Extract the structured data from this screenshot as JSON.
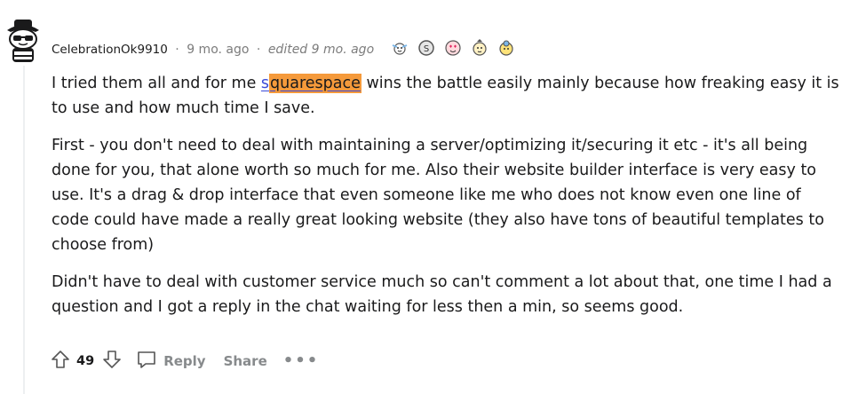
{
  "comment": {
    "username": "CelebrationOk9910",
    "sep1": "·",
    "age": "9 mo. ago",
    "sep2": "·",
    "edited": "edited 9 mo. ago",
    "awards": [
      "wholesome-award-icon",
      "silver-award-icon",
      "heart-eyes-award-icon",
      "helpful-award-icon",
      "gold-award-icon"
    ],
    "paragraphs": {
      "p1_before": "I tried them all and for me ",
      "p1_link_s": "s",
      "p1_link_rest": "quarespace",
      "p1_after": " wins the battle easily mainly because how freaking easy it is to use and how much time I save.",
      "p2": "First - you don't need to deal with maintaining a server/optimizing it/securing it etc - it's all being done for you, that alone worth so much for me. Also their website builder interface is very easy to use. It's a drag & drop interface that even someone like me who does not know even one line of code could have made a really great looking website (they also have tons of beautiful templates to choose from)",
      "p3": "Didn't have to deal with customer service much so can't comment a lot about that, one time I had a question and I got a reply in the chat waiting for less then a min, so seems good."
    },
    "actions": {
      "score": "49",
      "reply_label": "Reply",
      "share_label": "Share",
      "more_label": "•••"
    }
  },
  "colors": {
    "highlight": "#f59a3b",
    "link": "#3b4ad8",
    "muted": "#878a8c"
  }
}
